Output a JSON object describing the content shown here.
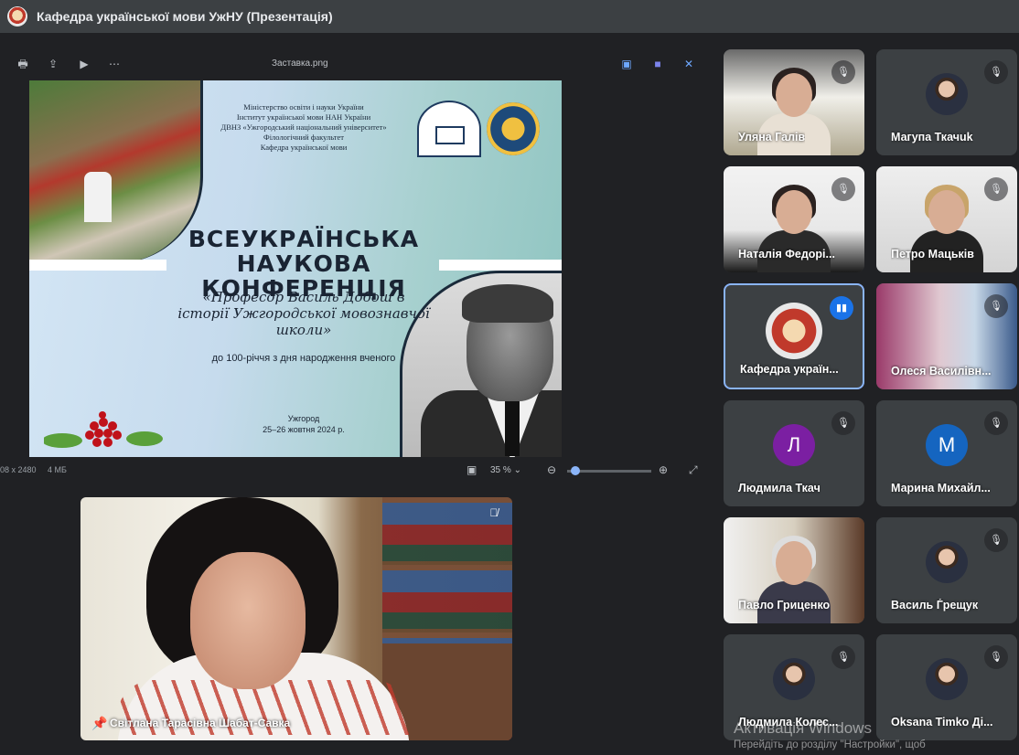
{
  "window": {
    "title": "Кафедра української мови УжНУ (Презентація)"
  },
  "viewer": {
    "filename": "Заставка.png",
    "toolbar_left_icons": [
      "print-icon",
      "share-icon",
      "present-icon",
      "more-icon"
    ],
    "toolbar_right_icons": [
      "image-edit-icon",
      "teams-icon",
      "close-share-icon"
    ],
    "dimensions": "08 x 2480",
    "file_size": "4 МБ",
    "zoom": "35 %"
  },
  "slide": {
    "ministry_lines": [
      "Міністерство освіти і науки України",
      "Інститут української мови НАН України",
      "ДВНЗ «Ужгородський національний університет»",
      "Філологічний факультет",
      "Кафедра української мови"
    ],
    "title_line1": "ВСЕУКРАЇНСЬКА",
    "title_line2": "НАУКОВА КОНФЕРЕНЦІЯ",
    "subtitle": "«Професор Василь Добош в історії Ужгородської мовознавчої школи»",
    "century": "до 100-річчя з дня народження вченого",
    "city": "Ужгород",
    "dates": "25–26 жовтня 2024 р."
  },
  "speaker": {
    "name": "Світлана Тарасівна Шабат-Савка"
  },
  "participants": [
    {
      "name": "Уляна Галів"
    },
    {
      "name": "Магупа Ткачuk"
    },
    {
      "name": "Наталія Федорі..."
    },
    {
      "name": "Петро Мацьків"
    },
    {
      "name": "Кафедра україн..."
    },
    {
      "name": "Олеся Василівн..."
    },
    {
      "name": "Людмила Ткач",
      "initial": "Л",
      "color": "#7b1fa2"
    },
    {
      "name": "Марина Михайл...",
      "initial": "М",
      "color": "#1565c0"
    },
    {
      "name": "Павло Гриценко"
    },
    {
      "name": "Василь Ѓрещук"
    },
    {
      "name": "Людмила Колес..."
    },
    {
      "name": "Oksana Timko Ді..."
    }
  ],
  "watermark": {
    "line1": "Активація Windows",
    "line2": "Перейдіть до розділу \"Настройки\", щоб"
  }
}
